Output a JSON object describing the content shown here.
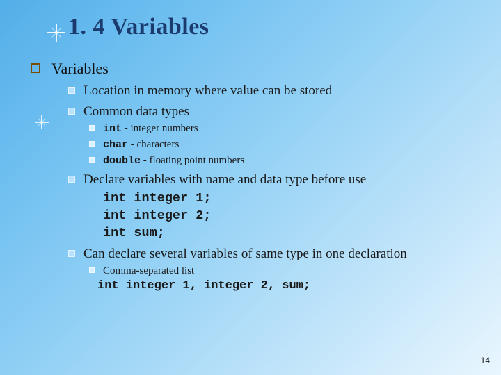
{
  "slide": {
    "title": "1. 4 Variables",
    "section_heading": "Variables",
    "bullets": [
      {
        "text": "Location in memory where value can be stored"
      },
      {
        "text": "Common data types",
        "sub": [
          {
            "code": "int",
            "desc": " - integer numbers"
          },
          {
            "code": "char",
            "desc": " - characters"
          },
          {
            "code": "double",
            "desc": " - floating point numbers"
          }
        ]
      },
      {
        "text": "Declare variables with name and data type before use",
        "code_lines": [
          "int integer 1;",
          "int integer 2;",
          "int sum;"
        ]
      },
      {
        "text": "Can declare several variables of same type in one declaration",
        "sub_text": [
          {
            "text": "Comma-separated list"
          }
        ],
        "code_line": "int integer 1, integer 2, sum;"
      }
    ],
    "page_number": "14"
  }
}
